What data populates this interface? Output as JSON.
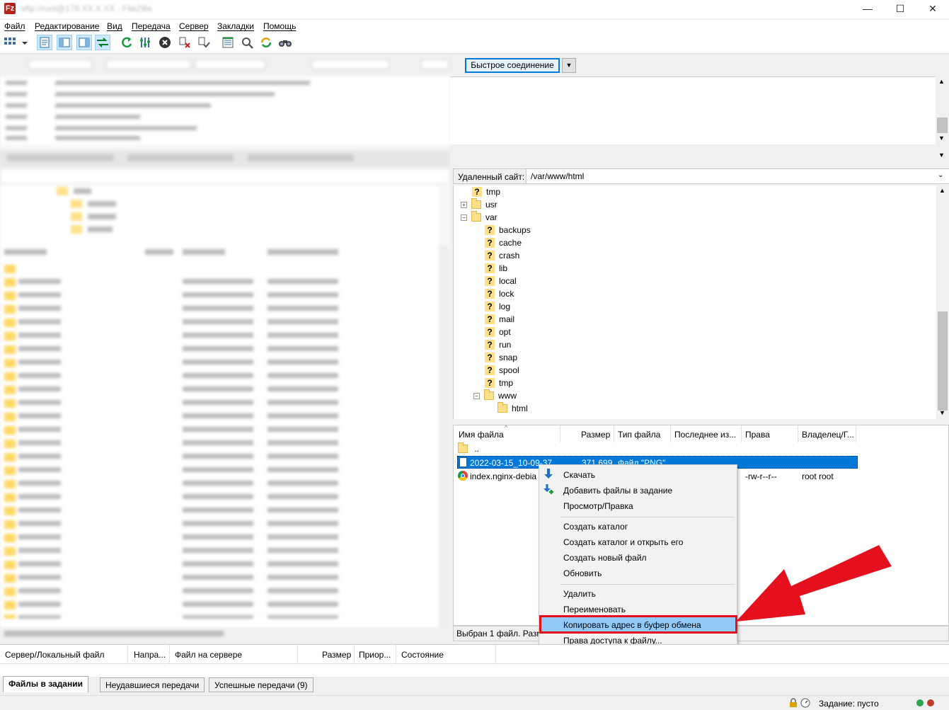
{
  "window": {
    "title": "sftp://root@178.XX.X.XX - FileZilla",
    "minimize": "—",
    "maximize": "☐",
    "close": "✕"
  },
  "menu": [
    "Файл",
    "Редактирование",
    "Вид",
    "Передача",
    "Сервер",
    "Закладки",
    "Помощь"
  ],
  "quickconnect": {
    "label": "Быстрое соединение"
  },
  "remote_site": {
    "label": "Удаленный сайт:",
    "path": "/var/www/html"
  },
  "tree": {
    "items": [
      {
        "name": "tmp",
        "level": 1,
        "icon": "question-folder"
      },
      {
        "name": "usr",
        "level": 1,
        "icon": "folder",
        "expander": "+"
      },
      {
        "name": "var",
        "level": 1,
        "icon": "folder",
        "expander": "−"
      },
      {
        "name": "backups",
        "level": 2,
        "icon": "question-folder"
      },
      {
        "name": "cache",
        "level": 2,
        "icon": "question-folder"
      },
      {
        "name": "crash",
        "level": 2,
        "icon": "question-folder"
      },
      {
        "name": "lib",
        "level": 2,
        "icon": "question-folder"
      },
      {
        "name": "local",
        "level": 2,
        "icon": "question-folder"
      },
      {
        "name": "lock",
        "level": 2,
        "icon": "question-folder"
      },
      {
        "name": "log",
        "level": 2,
        "icon": "question-folder"
      },
      {
        "name": "mail",
        "level": 2,
        "icon": "question-folder"
      },
      {
        "name": "opt",
        "level": 2,
        "icon": "question-folder"
      },
      {
        "name": "run",
        "level": 2,
        "icon": "question-folder"
      },
      {
        "name": "snap",
        "level": 2,
        "icon": "question-folder"
      },
      {
        "name": "spool",
        "level": 2,
        "icon": "question-folder"
      },
      {
        "name": "tmp",
        "level": 2,
        "icon": "question-folder"
      },
      {
        "name": "www",
        "level": 2,
        "icon": "folder",
        "expander": "−"
      },
      {
        "name": "html",
        "level": 3,
        "icon": "folder"
      }
    ]
  },
  "filelist": {
    "columns": [
      "Имя файла",
      "Размер",
      "Тип файла",
      "Последнее из...",
      "Права",
      "Владелец/Г..."
    ],
    "rows": [
      {
        "name": "..",
        "size": "",
        "type": "",
        "perms": "",
        "owner": ""
      },
      {
        "name": "2022-03-15_10-09-37...",
        "size": "371 699",
        "type": "Файл \"PNG\"",
        "perms": "",
        "owner": ""
      },
      {
        "name": "index.nginx-debia",
        "size": "",
        "type": "",
        "perms": "-rw-r--r--",
        "owner": "root root"
      }
    ],
    "status": "Выбран 1 файл. Разм"
  },
  "context_menu": {
    "items": [
      "Скачать",
      "Добавить файлы в задание",
      "Просмотр/Правка",
      "Создать каталог",
      "Создать каталог и открыть его",
      "Создать новый файл",
      "Обновить",
      "Удалить",
      "Переименовать",
      "Копировать адрес в буфер обмена",
      "Права доступа к файлу..."
    ],
    "highlight_color": "#e5101e"
  },
  "queue": {
    "columns": [
      "Сервер/Локальный файл",
      "Напра...",
      "Файл на сервере",
      "Размер",
      "Приор...",
      "Состояние"
    ]
  },
  "tabs": [
    "Файлы в задании",
    "Неудавшиеся передачи",
    "Успешные передачи (9)"
  ],
  "statusbar": {
    "queue": "Задание: пусто"
  }
}
